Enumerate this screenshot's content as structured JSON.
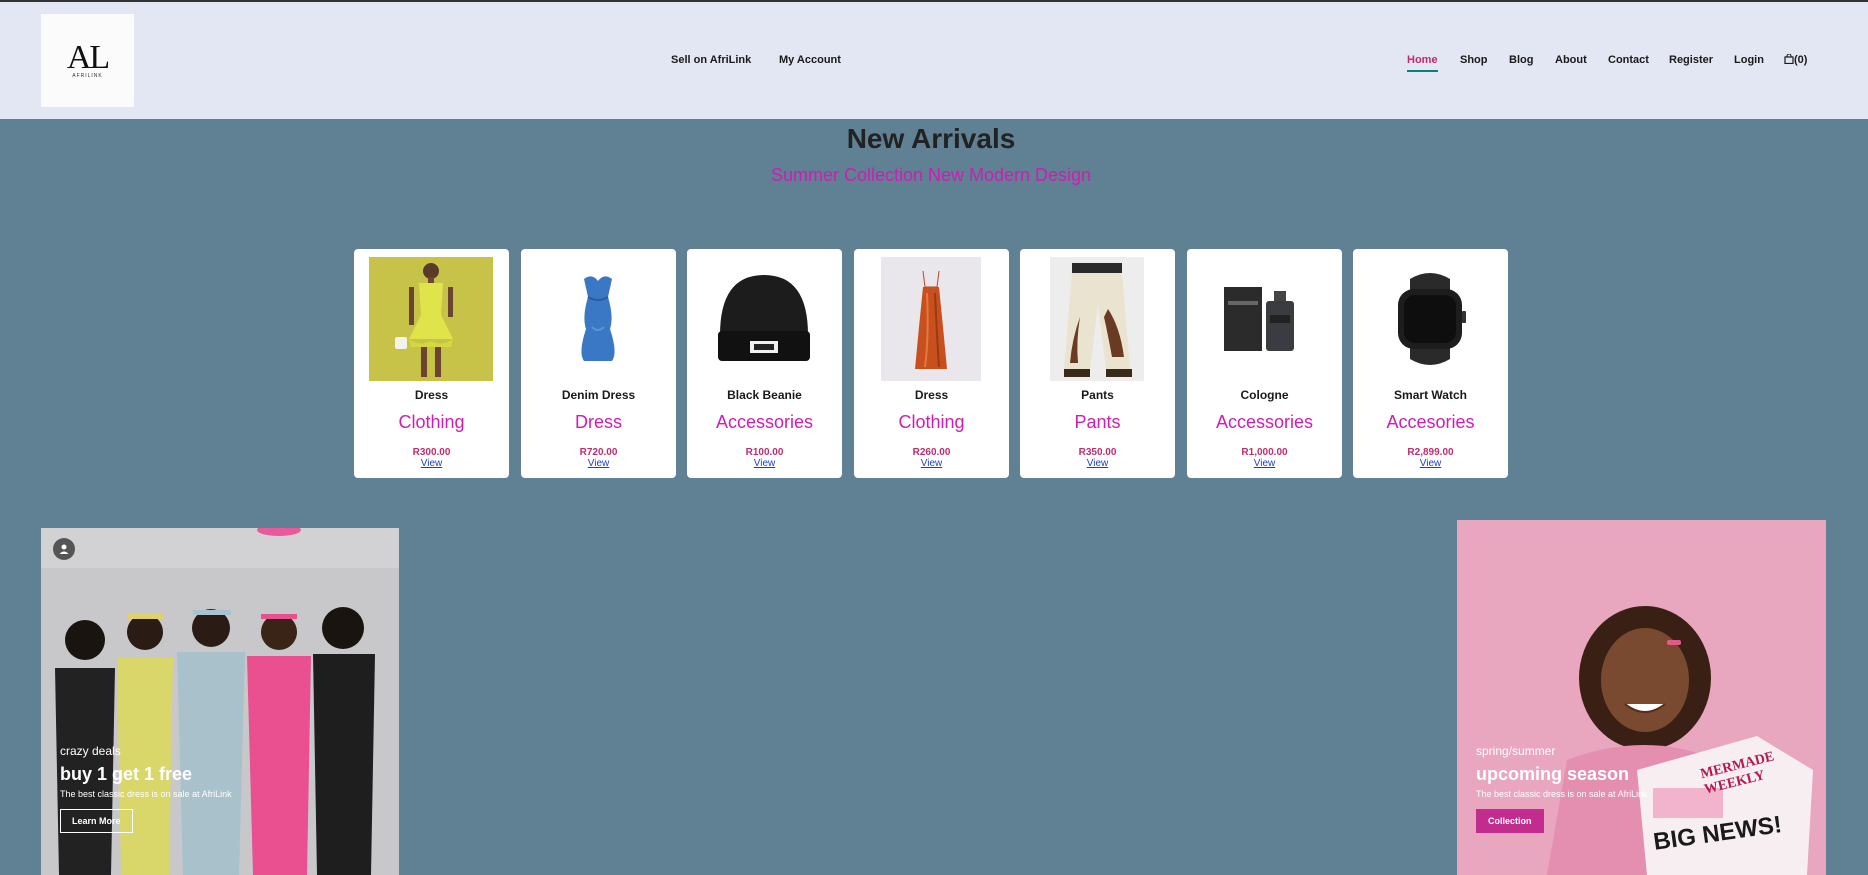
{
  "logo": {
    "mark": "AL",
    "small_text": "AFRILINK"
  },
  "secondary_nav": [
    {
      "label": "Sell on AfriLink"
    },
    {
      "label": "My Account"
    }
  ],
  "nav": [
    {
      "label": "Home"
    },
    {
      "label": "Shop"
    },
    {
      "label": "Blog"
    },
    {
      "label": "About"
    },
    {
      "label": "Contact"
    },
    {
      "label": "Register"
    },
    {
      "label": "Login"
    }
  ],
  "cart": {
    "count": "(0)"
  },
  "section": {
    "title": "New Arrivals",
    "subtitle": "Summer Collection New Modern Design"
  },
  "products": [
    {
      "name": "Dress",
      "category": "Clothing",
      "price": "R300.00",
      "link": "View"
    },
    {
      "name": "Denim Dress",
      "category": "Dress",
      "price": "R720.00",
      "link": "View"
    },
    {
      "name": "Black Beanie",
      "category": "Accessories",
      "price": "R100.00",
      "link": "View"
    },
    {
      "name": "Dress",
      "category": "Clothing",
      "price": "R260.00",
      "link": "View"
    },
    {
      "name": "Pants",
      "category": "Pants",
      "price": "R350.00",
      "link": "View"
    },
    {
      "name": "Cologne",
      "category": "Accessories",
      "price": "R1,000.00",
      "link": "View"
    },
    {
      "name": "Smart Watch",
      "category": "Accesories",
      "price": "R2,899.00",
      "link": "View"
    }
  ],
  "banner_left": {
    "kicker": "crazy deals",
    "title": "buy 1 get 1 free",
    "description": "The best classic dress is on sale at AfriLink",
    "button": "Learn More"
  },
  "banner_right": {
    "kicker": "spring/summer",
    "title": "upcoming season",
    "description": "The best classic dress is on sale at AfriLink",
    "button": "Collection",
    "magazine_title": "MERMADE WEEKLY",
    "magazine_headline": "BIG NEWS!"
  },
  "colors": {
    "page_bg": "#5f8193",
    "header_bg": "#e3e6f3",
    "accent_pink": "#d11bb5",
    "price_pink": "#c12c6e",
    "active_underline": "#088178",
    "button_pink": "#c22c8e"
  }
}
